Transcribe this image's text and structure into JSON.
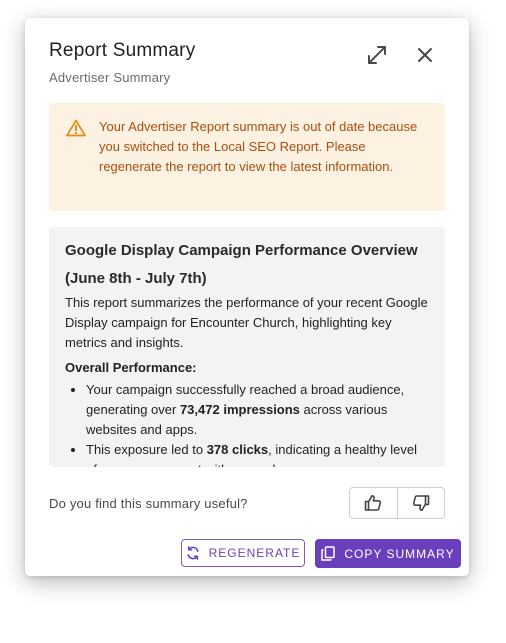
{
  "header": {
    "title": "Report Summary",
    "subtitle": "Advertiser Summary",
    "expand_icon": "expand-icon",
    "close_icon": "close-icon"
  },
  "warning": {
    "icon": "warning-triangle-icon",
    "text": "Your Advertiser Report summary is out of date because you switched to the Local SEO Report. Please regenerate the report to view the latest information.",
    "background": "#fdf1e2",
    "color": "#a94f0d"
  },
  "summary": {
    "title": "Google Display Campaign Performance Overview (June 8th - July 7th)",
    "intro": "This report summarizes the performance of your recent Google Display campaign for Encounter Church, highlighting key metrics and insights.",
    "section_heading": "Overall Performance:",
    "bullets": [
      {
        "before": "Your campaign successfully reached a broad audience, generating over ",
        "bold": "73,472 impressions",
        "after": " across various websites and apps."
      },
      {
        "before": "This exposure led to ",
        "bold": "378 clicks",
        "after": ", indicating a healthy level of user engagement with your ads."
      }
    ]
  },
  "feedback": {
    "question": "Do you find this summary useful?",
    "thumbs_up_icon": "thumbs-up-icon",
    "thumbs_down_icon": "thumbs-down-icon"
  },
  "actions": {
    "regenerate_label": "REGENERATE",
    "regenerate_icon": "refresh-icon",
    "copy_label": "COPY SUMMARY",
    "copy_icon": "copy-icon",
    "accent": "#6a3fbc"
  }
}
